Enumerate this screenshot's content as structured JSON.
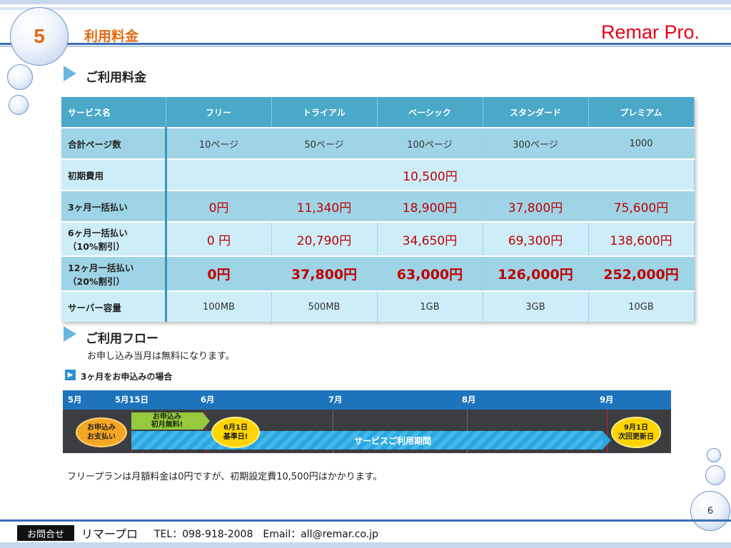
{
  "header": {
    "section_number": "5",
    "title": "利用料金",
    "brand": "Remar Pro."
  },
  "pricing": {
    "heading": "ご利用料金",
    "columns": [
      "サービス名",
      "フリー",
      "トライアル",
      "ベーシック",
      "スタンダード",
      "プレミアム"
    ],
    "rows": [
      {
        "label": "合計ページ数",
        "values": [
          "10ページ",
          "50ページ",
          "100ページ",
          "300ページ",
          "1000"
        ]
      },
      {
        "label": "初期費用",
        "merged_value": "10,500円"
      },
      {
        "label": "3ヶ月一括払い",
        "values": [
          "0円",
          "11,340円",
          "18,900円",
          "37,800円",
          "75,600円"
        ]
      },
      {
        "label_line1": "6ヶ月一括払い",
        "label_line2": "（10%割引）",
        "values": [
          "0 円",
          "20,790円",
          "34,650円",
          "69,300円",
          "138,600円"
        ]
      },
      {
        "label_line1": "12ヶ月一括払い",
        "label_line2": "（20%割引）",
        "values": [
          "0円",
          "37,800円",
          "63,000円",
          "126,000円",
          "252,000円"
        ]
      },
      {
        "label": "サーバー容量",
        "values": [
          "100MB",
          "500MB",
          "1GB",
          "3GB",
          "10GB"
        ]
      }
    ]
  },
  "flow": {
    "heading": "ご利用フロー",
    "note": "お申し込み当月は無料になります。",
    "case_label": "3ヶ月をお申込みの場合",
    "months": [
      "5月",
      "5月15日",
      "6月",
      "7月",
      "8月",
      "9月"
    ],
    "apply_bubble_line1": "お申込み",
    "apply_bubble_line2": "お支払い",
    "free_banner_line1": "お申込み",
    "free_banner_line2": "初月無料!",
    "base_day_line1": "6月1日",
    "base_day_line2": "基準日!",
    "service_period": "サービスご利用期間",
    "renew_line1": "9月1日",
    "renew_line2": "次回更新日"
  },
  "footnote": "フリープランは月額料金は0円ですが、初期設定費10,500円はかかります。",
  "page_number": "6",
  "footer": {
    "contact_label": "お問合せ",
    "company": "リマープロ",
    "contact_info": "TEL：098-918-2008　Email：all@remar.co.jp"
  },
  "colors": {
    "accent_orange": "#e56a12",
    "brand_red": "#e6001a",
    "price_red": "#c00000",
    "table_header": "#4aa8c9"
  }
}
